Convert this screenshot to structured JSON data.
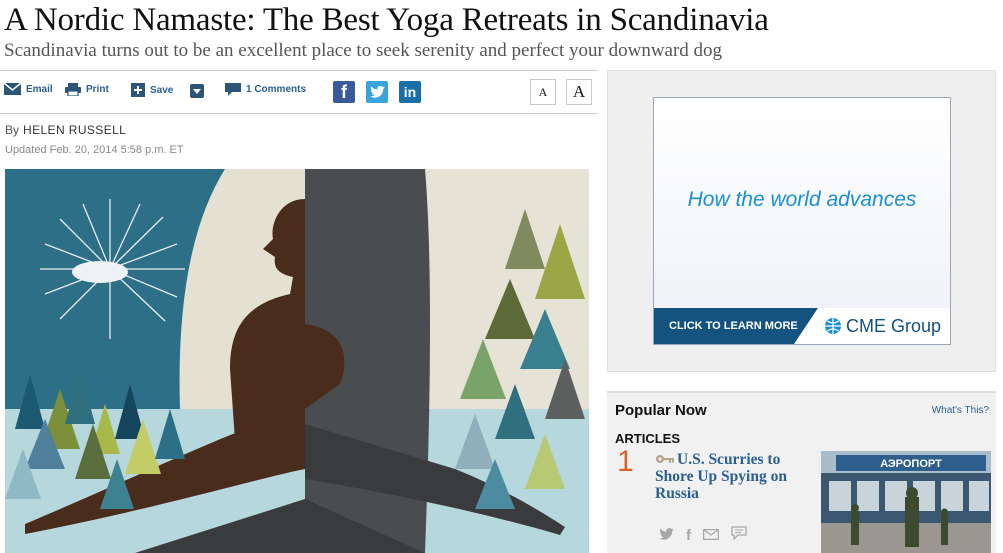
{
  "article": {
    "headline": "A Nordic Namaste: The Best Yoga Retreats in Scandinavia",
    "subhead": "Scandinavia turns out to be an excellent place to seek serenity and perfect your downward dog",
    "byline_prefix": "By",
    "author": "HELEN RUSSELL",
    "updated": "Updated Feb. 20, 2014 5:58 p.m. ET"
  },
  "toolbar": {
    "email_label": "Email",
    "print_label": "Print",
    "save_label": "Save",
    "comments_label": "1 Comments",
    "facebook_glyph": "f",
    "twitter_glyph": "t",
    "linkedin_glyph": "in",
    "font_small_label": "A",
    "font_large_label": "A"
  },
  "ad": {
    "tagline": "How the world advances",
    "cta": "CLICK TO LEARN MORE",
    "brand": "CME Group"
  },
  "popular": {
    "title": "Popular Now",
    "whats_this": "What's This?",
    "section": "ARTICLES",
    "items": [
      {
        "rank": "1",
        "headline": "U.S. Scurries to Shore Up Spying on Russia",
        "photo_sign": "АЭРОПОРТ"
      }
    ],
    "share_icons": [
      "twitter-icon",
      "facebook-icon",
      "email-icon",
      "comment-icon"
    ]
  },
  "colors": {
    "link_blue": "#2b5f8f",
    "rank_orange": "#d9642b",
    "ad_blue": "#1a8fd1",
    "ad_navy": "#14527f"
  }
}
